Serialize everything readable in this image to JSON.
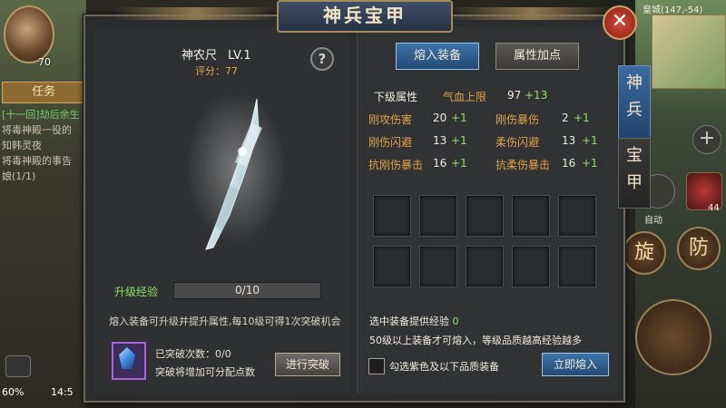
{
  "hud": {
    "player_level": "70",
    "task_tab_label": "任务",
    "quest_lines": [
      "[十一回]劫后余生",
      "将毒神殿一役的",
      "知韩灵夜",
      "将毒神殿的事告",
      "娘(1/1)"
    ],
    "battery": "60%",
    "clock": "14:5",
    "map_label": "皇城(147,-54)",
    "skill1_label": "旋",
    "skill2_label": "防",
    "auto_label": "自动",
    "plus_label": "+",
    "potion_count": "44"
  },
  "panel": {
    "title": "神兵宝甲",
    "close_label": "✕"
  },
  "item": {
    "name": "神农尺",
    "level": "LV.1",
    "score_label": "评分：",
    "score": "77",
    "help_label": "?"
  },
  "exp": {
    "label": "升级经验",
    "value": "0/10"
  },
  "hint": "熔入装备可升级并提升属性,每10级可得1次突破机会",
  "breakthrough": {
    "count_label": "已突破次数：",
    "count": "0/0",
    "desc": "突破将增加可分配点数",
    "button": "进行突破"
  },
  "tabs": {
    "fuse": "熔入装备",
    "attr_points": "属性加点"
  },
  "next_level": {
    "header": "下级属性",
    "hp_name": "气血上限",
    "hp_value": "97",
    "hp_up": "+13"
  },
  "attributes": [
    {
      "name": "刚攻伤害",
      "value": "20",
      "up": "+1"
    },
    {
      "name": "刚伤暴伤",
      "value": "2",
      "up": "+1"
    },
    {
      "name": "刚伤闪避",
      "value": "13",
      "up": "+1"
    },
    {
      "name": "柔伤闪避",
      "value": "13",
      "up": "+1"
    },
    {
      "name": "抗刚伤暴击",
      "value": "16",
      "up": "+1"
    },
    {
      "name": "抗柔伤暴击",
      "value": "16",
      "up": "+1"
    }
  ],
  "provide": {
    "label": "选中装备提供经验",
    "value": "0"
  },
  "rule": "50级以上装备才可熔入，等级品质越高经验越多",
  "select_label": "勾选紫色及以下品质装备",
  "fuse_button": "立即熔入",
  "side_tabs": {
    "weapon": "神兵",
    "armor": "宝甲"
  },
  "colors": {
    "accent_gold": "#e3a34a",
    "bonus_green": "#8ee26a",
    "active_tab_blue": "#3d73a8"
  }
}
